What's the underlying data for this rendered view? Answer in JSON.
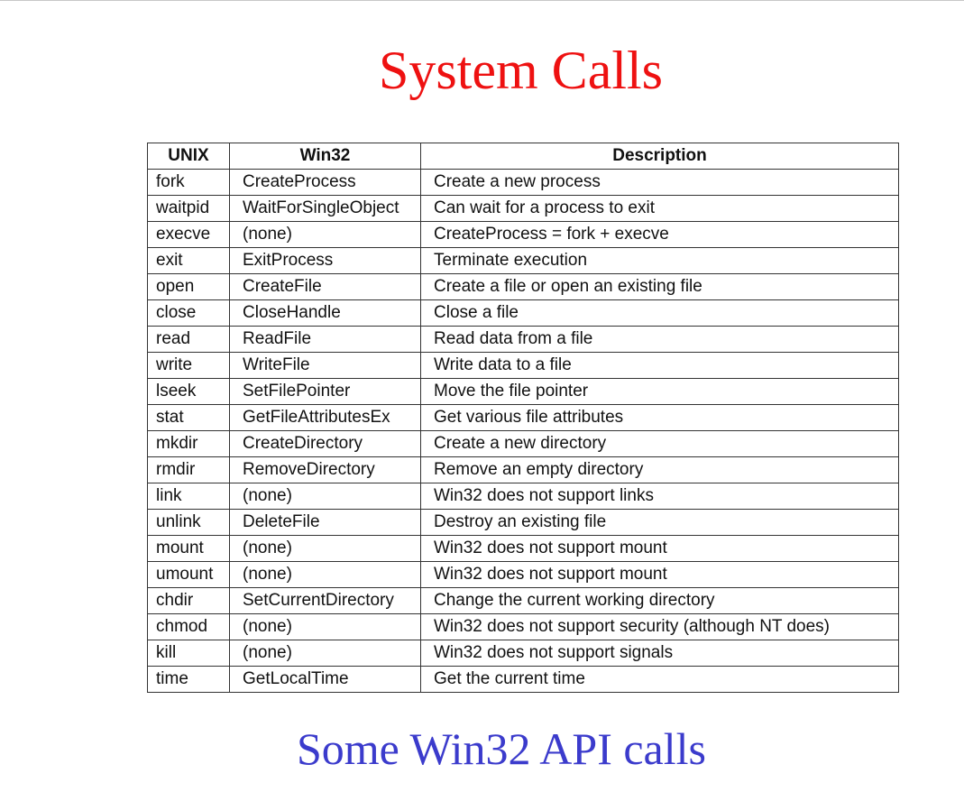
{
  "title": "System Calls",
  "table": {
    "headers": [
      "UNIX",
      "Win32",
      "Description"
    ],
    "rows": [
      {
        "unix": "fork",
        "win32": "CreateProcess",
        "description": "Create a new process"
      },
      {
        "unix": "waitpid",
        "win32": "WaitForSingleObject",
        "description": "Can wait for a process to exit"
      },
      {
        "unix": "execve",
        "win32": "(none)",
        "description": "CreateProcess = fork + execve"
      },
      {
        "unix": "exit",
        "win32": "ExitProcess",
        "description": "Terminate execution"
      },
      {
        "unix": "open",
        "win32": "CreateFile",
        "description": "Create a file or open an existing file"
      },
      {
        "unix": "close",
        "win32": "CloseHandle",
        "description": "Close a file"
      },
      {
        "unix": "read",
        "win32": "ReadFile",
        "description": "Read data from a file"
      },
      {
        "unix": "write",
        "win32": "WriteFile",
        "description": "Write data to a file"
      },
      {
        "unix": "lseek",
        "win32": "SetFilePointer",
        "description": "Move the file pointer"
      },
      {
        "unix": "stat",
        "win32": "GetFileAttributesEx",
        "description": "Get various file attributes"
      },
      {
        "unix": "mkdir",
        "win32": "CreateDirectory",
        "description": "Create a new directory"
      },
      {
        "unix": "rmdir",
        "win32": "RemoveDirectory",
        "description": "Remove an empty directory"
      },
      {
        "unix": "link",
        "win32": "(none)",
        "description": "Win32 does not support links"
      },
      {
        "unix": "unlink",
        "win32": "DeleteFile",
        "description": "Destroy an existing file"
      },
      {
        "unix": "mount",
        "win32": "(none)",
        "description": "Win32 does not support mount"
      },
      {
        "unix": "umount",
        "win32": "(none)",
        "description": "Win32 does not support mount"
      },
      {
        "unix": "chdir",
        "win32": "SetCurrentDirectory",
        "description": "Change the current working directory"
      },
      {
        "unix": "chmod",
        "win32": "(none)",
        "description": "Win32 does not support security (although NT does)"
      },
      {
        "unix": "kill",
        "win32": "(none)",
        "description": "Win32 does not support signals"
      },
      {
        "unix": "time",
        "win32": "GetLocalTime",
        "description": "Get the current time"
      }
    ]
  },
  "caption": "Some Win32 API calls",
  "colors": {
    "title": "#ee1111",
    "caption": "#3b3bcc",
    "table_text": "#111111",
    "table_border": "#333333"
  }
}
